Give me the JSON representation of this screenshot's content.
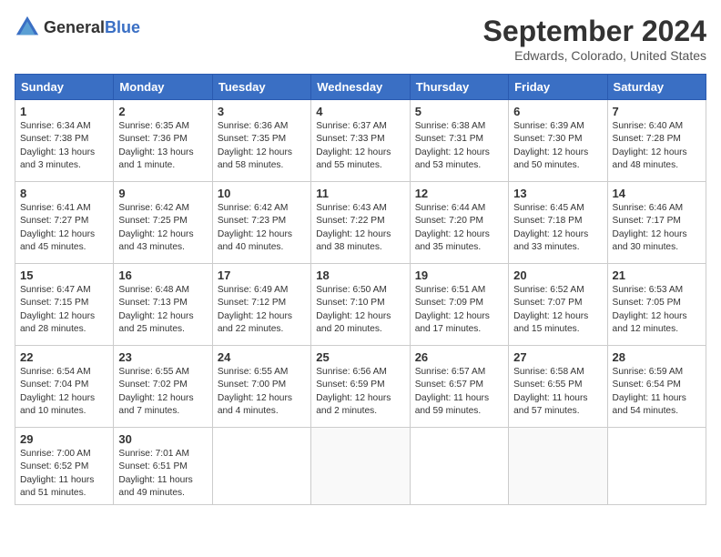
{
  "header": {
    "logo_general": "General",
    "logo_blue": "Blue",
    "month": "September 2024",
    "location": "Edwards, Colorado, United States"
  },
  "columns": [
    "Sunday",
    "Monday",
    "Tuesday",
    "Wednesday",
    "Thursday",
    "Friday",
    "Saturday"
  ],
  "weeks": [
    [
      {
        "day": "1",
        "sunrise": "6:34 AM",
        "sunset": "7:38 PM",
        "daylight": "13 hours and 3 minutes."
      },
      {
        "day": "2",
        "sunrise": "6:35 AM",
        "sunset": "7:36 PM",
        "daylight": "13 hours and 1 minute."
      },
      {
        "day": "3",
        "sunrise": "6:36 AM",
        "sunset": "7:35 PM",
        "daylight": "12 hours and 58 minutes."
      },
      {
        "day": "4",
        "sunrise": "6:37 AM",
        "sunset": "7:33 PM",
        "daylight": "12 hours and 55 minutes."
      },
      {
        "day": "5",
        "sunrise": "6:38 AM",
        "sunset": "7:31 PM",
        "daylight": "12 hours and 53 minutes."
      },
      {
        "day": "6",
        "sunrise": "6:39 AM",
        "sunset": "7:30 PM",
        "daylight": "12 hours and 50 minutes."
      },
      {
        "day": "7",
        "sunrise": "6:40 AM",
        "sunset": "7:28 PM",
        "daylight": "12 hours and 48 minutes."
      }
    ],
    [
      {
        "day": "8",
        "sunrise": "6:41 AM",
        "sunset": "7:27 PM",
        "daylight": "12 hours and 45 minutes."
      },
      {
        "day": "9",
        "sunrise": "6:42 AM",
        "sunset": "7:25 PM",
        "daylight": "12 hours and 43 minutes."
      },
      {
        "day": "10",
        "sunrise": "6:42 AM",
        "sunset": "7:23 PM",
        "daylight": "12 hours and 40 minutes."
      },
      {
        "day": "11",
        "sunrise": "6:43 AM",
        "sunset": "7:22 PM",
        "daylight": "12 hours and 38 minutes."
      },
      {
        "day": "12",
        "sunrise": "6:44 AM",
        "sunset": "7:20 PM",
        "daylight": "12 hours and 35 minutes."
      },
      {
        "day": "13",
        "sunrise": "6:45 AM",
        "sunset": "7:18 PM",
        "daylight": "12 hours and 33 minutes."
      },
      {
        "day": "14",
        "sunrise": "6:46 AM",
        "sunset": "7:17 PM",
        "daylight": "12 hours and 30 minutes."
      }
    ],
    [
      {
        "day": "15",
        "sunrise": "6:47 AM",
        "sunset": "7:15 PM",
        "daylight": "12 hours and 28 minutes."
      },
      {
        "day": "16",
        "sunrise": "6:48 AM",
        "sunset": "7:13 PM",
        "daylight": "12 hours and 25 minutes."
      },
      {
        "day": "17",
        "sunrise": "6:49 AM",
        "sunset": "7:12 PM",
        "daylight": "12 hours and 22 minutes."
      },
      {
        "day": "18",
        "sunrise": "6:50 AM",
        "sunset": "7:10 PM",
        "daylight": "12 hours and 20 minutes."
      },
      {
        "day": "19",
        "sunrise": "6:51 AM",
        "sunset": "7:09 PM",
        "daylight": "12 hours and 17 minutes."
      },
      {
        "day": "20",
        "sunrise": "6:52 AM",
        "sunset": "7:07 PM",
        "daylight": "12 hours and 15 minutes."
      },
      {
        "day": "21",
        "sunrise": "6:53 AM",
        "sunset": "7:05 PM",
        "daylight": "12 hours and 12 minutes."
      }
    ],
    [
      {
        "day": "22",
        "sunrise": "6:54 AM",
        "sunset": "7:04 PM",
        "daylight": "12 hours and 10 minutes."
      },
      {
        "day": "23",
        "sunrise": "6:55 AM",
        "sunset": "7:02 PM",
        "daylight": "12 hours and 7 minutes."
      },
      {
        "day": "24",
        "sunrise": "6:55 AM",
        "sunset": "7:00 PM",
        "daylight": "12 hours and 4 minutes."
      },
      {
        "day": "25",
        "sunrise": "6:56 AM",
        "sunset": "6:59 PM",
        "daylight": "12 hours and 2 minutes."
      },
      {
        "day": "26",
        "sunrise": "6:57 AM",
        "sunset": "6:57 PM",
        "daylight": "11 hours and 59 minutes."
      },
      {
        "day": "27",
        "sunrise": "6:58 AM",
        "sunset": "6:55 PM",
        "daylight": "11 hours and 57 minutes."
      },
      {
        "day": "28",
        "sunrise": "6:59 AM",
        "sunset": "6:54 PM",
        "daylight": "11 hours and 54 minutes."
      }
    ],
    [
      {
        "day": "29",
        "sunrise": "7:00 AM",
        "sunset": "6:52 PM",
        "daylight": "11 hours and 51 minutes."
      },
      {
        "day": "30",
        "sunrise": "7:01 AM",
        "sunset": "6:51 PM",
        "daylight": "11 hours and 49 minutes."
      },
      null,
      null,
      null,
      null,
      null
    ]
  ]
}
